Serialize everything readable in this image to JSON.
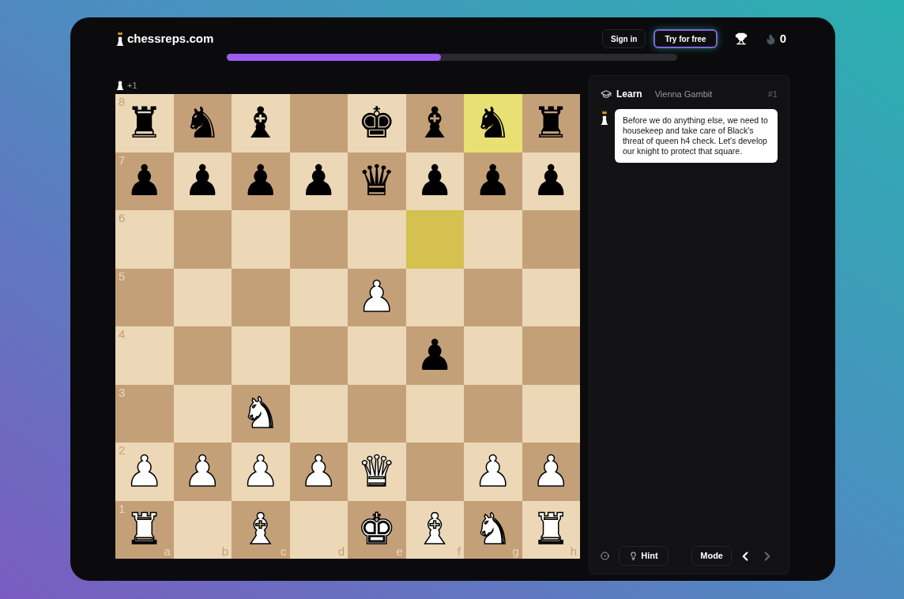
{
  "header": {
    "logo_text": "chessreps.com",
    "progress": {
      "level": 0.475
    },
    "buttons": [
      {
        "label": "Sign in",
        "kind": "plain"
      },
      {
        "label": "Try for free",
        "kind": "glow"
      }
    ],
    "streak": "0"
  },
  "material": {
    "text": "+1"
  },
  "board": {
    "files": [
      "a",
      "b",
      "c",
      "d",
      "e",
      "f",
      "g",
      "h"
    ],
    "ranks": [
      {
        "label": "8",
        "squares": [
          {
            "piece": "♜",
            "white": false,
            "highlighted": false
          },
          {
            "piece": "♞",
            "white": false,
            "highlighted": false
          },
          {
            "piece": "♝",
            "white": false,
            "highlighted": false
          },
          {
            "highlighted": false
          },
          {
            "piece": "♚",
            "white": false,
            "highlighted": false
          },
          {
            "piece": "♝",
            "white": false,
            "highlighted": false
          },
          {
            "piece": "♞",
            "white": false,
            "highlighted": true
          },
          {
            "piece": "♜",
            "white": false,
            "highlighted": false
          }
        ]
      },
      {
        "label": "7",
        "squares": [
          {
            "piece": "♟",
            "white": false,
            "highlighted": false
          },
          {
            "piece": "♟",
            "white": false,
            "highlighted": false
          },
          {
            "piece": "♟",
            "white": false,
            "highlighted": false
          },
          {
            "piece": "♟",
            "white": false,
            "highlighted": false
          },
          {
            "piece": "♛",
            "white": false,
            "highlighted": false
          },
          {
            "piece": "♟",
            "white": false,
            "highlighted": false
          },
          {
            "piece": "♟",
            "white": false,
            "highlighted": false
          },
          {
            "piece": "♟",
            "white": false,
            "highlighted": false
          }
        ]
      },
      {
        "label": "6",
        "squares": [
          {
            "highlighted": false
          },
          {
            "highlighted": false
          },
          {
            "highlighted": false
          },
          {
            "highlighted": false
          },
          {
            "highlighted": false
          },
          {
            "highlighted": true
          },
          {
            "highlighted": false
          },
          {
            "highlighted": false
          }
        ]
      },
      {
        "label": "5",
        "squares": [
          {
            "highlighted": false
          },
          {
            "highlighted": false
          },
          {
            "highlighted": false
          },
          {
            "highlighted": false
          },
          {
            "piece": "♟",
            "white": true,
            "highlighted": false
          },
          {
            "highlighted": false
          },
          {
            "highlighted": false
          },
          {
            "highlighted": false
          }
        ]
      },
      {
        "label": "4",
        "squares": [
          {
            "highlighted": false
          },
          {
            "highlighted": false
          },
          {
            "highlighted": false
          },
          {
            "highlighted": false
          },
          {
            "highlighted": false
          },
          {
            "piece": "♟",
            "white": false,
            "highlighted": false
          },
          {
            "highlighted": false
          },
          {
            "highlighted": false
          }
        ]
      },
      {
        "label": "3",
        "squares": [
          {
            "highlighted": false
          },
          {
            "highlighted": false
          },
          {
            "piece": "♞",
            "white": true,
            "highlighted": false
          },
          {
            "highlighted": false
          },
          {
            "highlighted": false
          },
          {
            "highlighted": false
          },
          {
            "highlighted": false
          },
          {
            "highlighted": false
          }
        ]
      },
      {
        "label": "2",
        "squares": [
          {
            "piece": "♟",
            "white": true,
            "highlighted": false
          },
          {
            "piece": "♟",
            "white": true,
            "highlighted": false
          },
          {
            "piece": "♟",
            "white": true,
            "highlighted": false
          },
          {
            "piece": "♟",
            "white": true,
            "highlighted": false
          },
          {
            "piece": "♛",
            "white": true,
            "highlighted": false
          },
          {
            "highlighted": false
          },
          {
            "piece": "♟",
            "white": true,
            "highlighted": false
          },
          {
            "piece": "♟",
            "white": true,
            "highlighted": false
          }
        ]
      },
      {
        "label": "1",
        "squares": [
          {
            "piece": "♜",
            "white": true,
            "highlighted": false
          },
          {
            "highlighted": false
          },
          {
            "piece": "♝",
            "white": true,
            "highlighted": false
          },
          {
            "highlighted": false
          },
          {
            "piece": "♚",
            "white": true,
            "highlighted": false
          },
          {
            "piece": "♝",
            "white": true,
            "highlighted": false
          },
          {
            "piece": "♞",
            "white": true,
            "highlighted": false
          },
          {
            "piece": "♜",
            "white": true,
            "highlighted": false
          }
        ]
      }
    ]
  },
  "panel": {
    "mode_label": "Learn",
    "opening": "Vienna Gambit",
    "number": "#1",
    "message": "Before we do anything else, we need to housekeep and take care of Black's threat of queen h4 check. Let's develop our knight to protect that square.",
    "hint": "Hint",
    "mode_button": "Mode",
    "prev_disabled": false,
    "next_disabled": true
  }
}
